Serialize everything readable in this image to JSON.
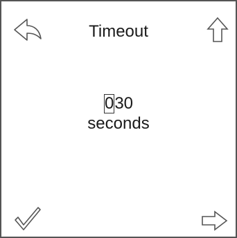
{
  "screen": {
    "title": "Timeout",
    "value": {
      "digits": [
        "0",
        "3",
        "0"
      ],
      "cursor_index": 0,
      "unit": "seconds"
    }
  },
  "buttons": {
    "back": {
      "icon": "back-arrow-icon"
    },
    "up": {
      "icon": "up-arrow-icon"
    },
    "confirm": {
      "icon": "checkmark-icon"
    },
    "next": {
      "icon": "right-arrow-icon"
    }
  },
  "colors": {
    "border": "#555555",
    "stroke": "#555555",
    "text": "#1a1a1a",
    "background": "#ffffff"
  }
}
